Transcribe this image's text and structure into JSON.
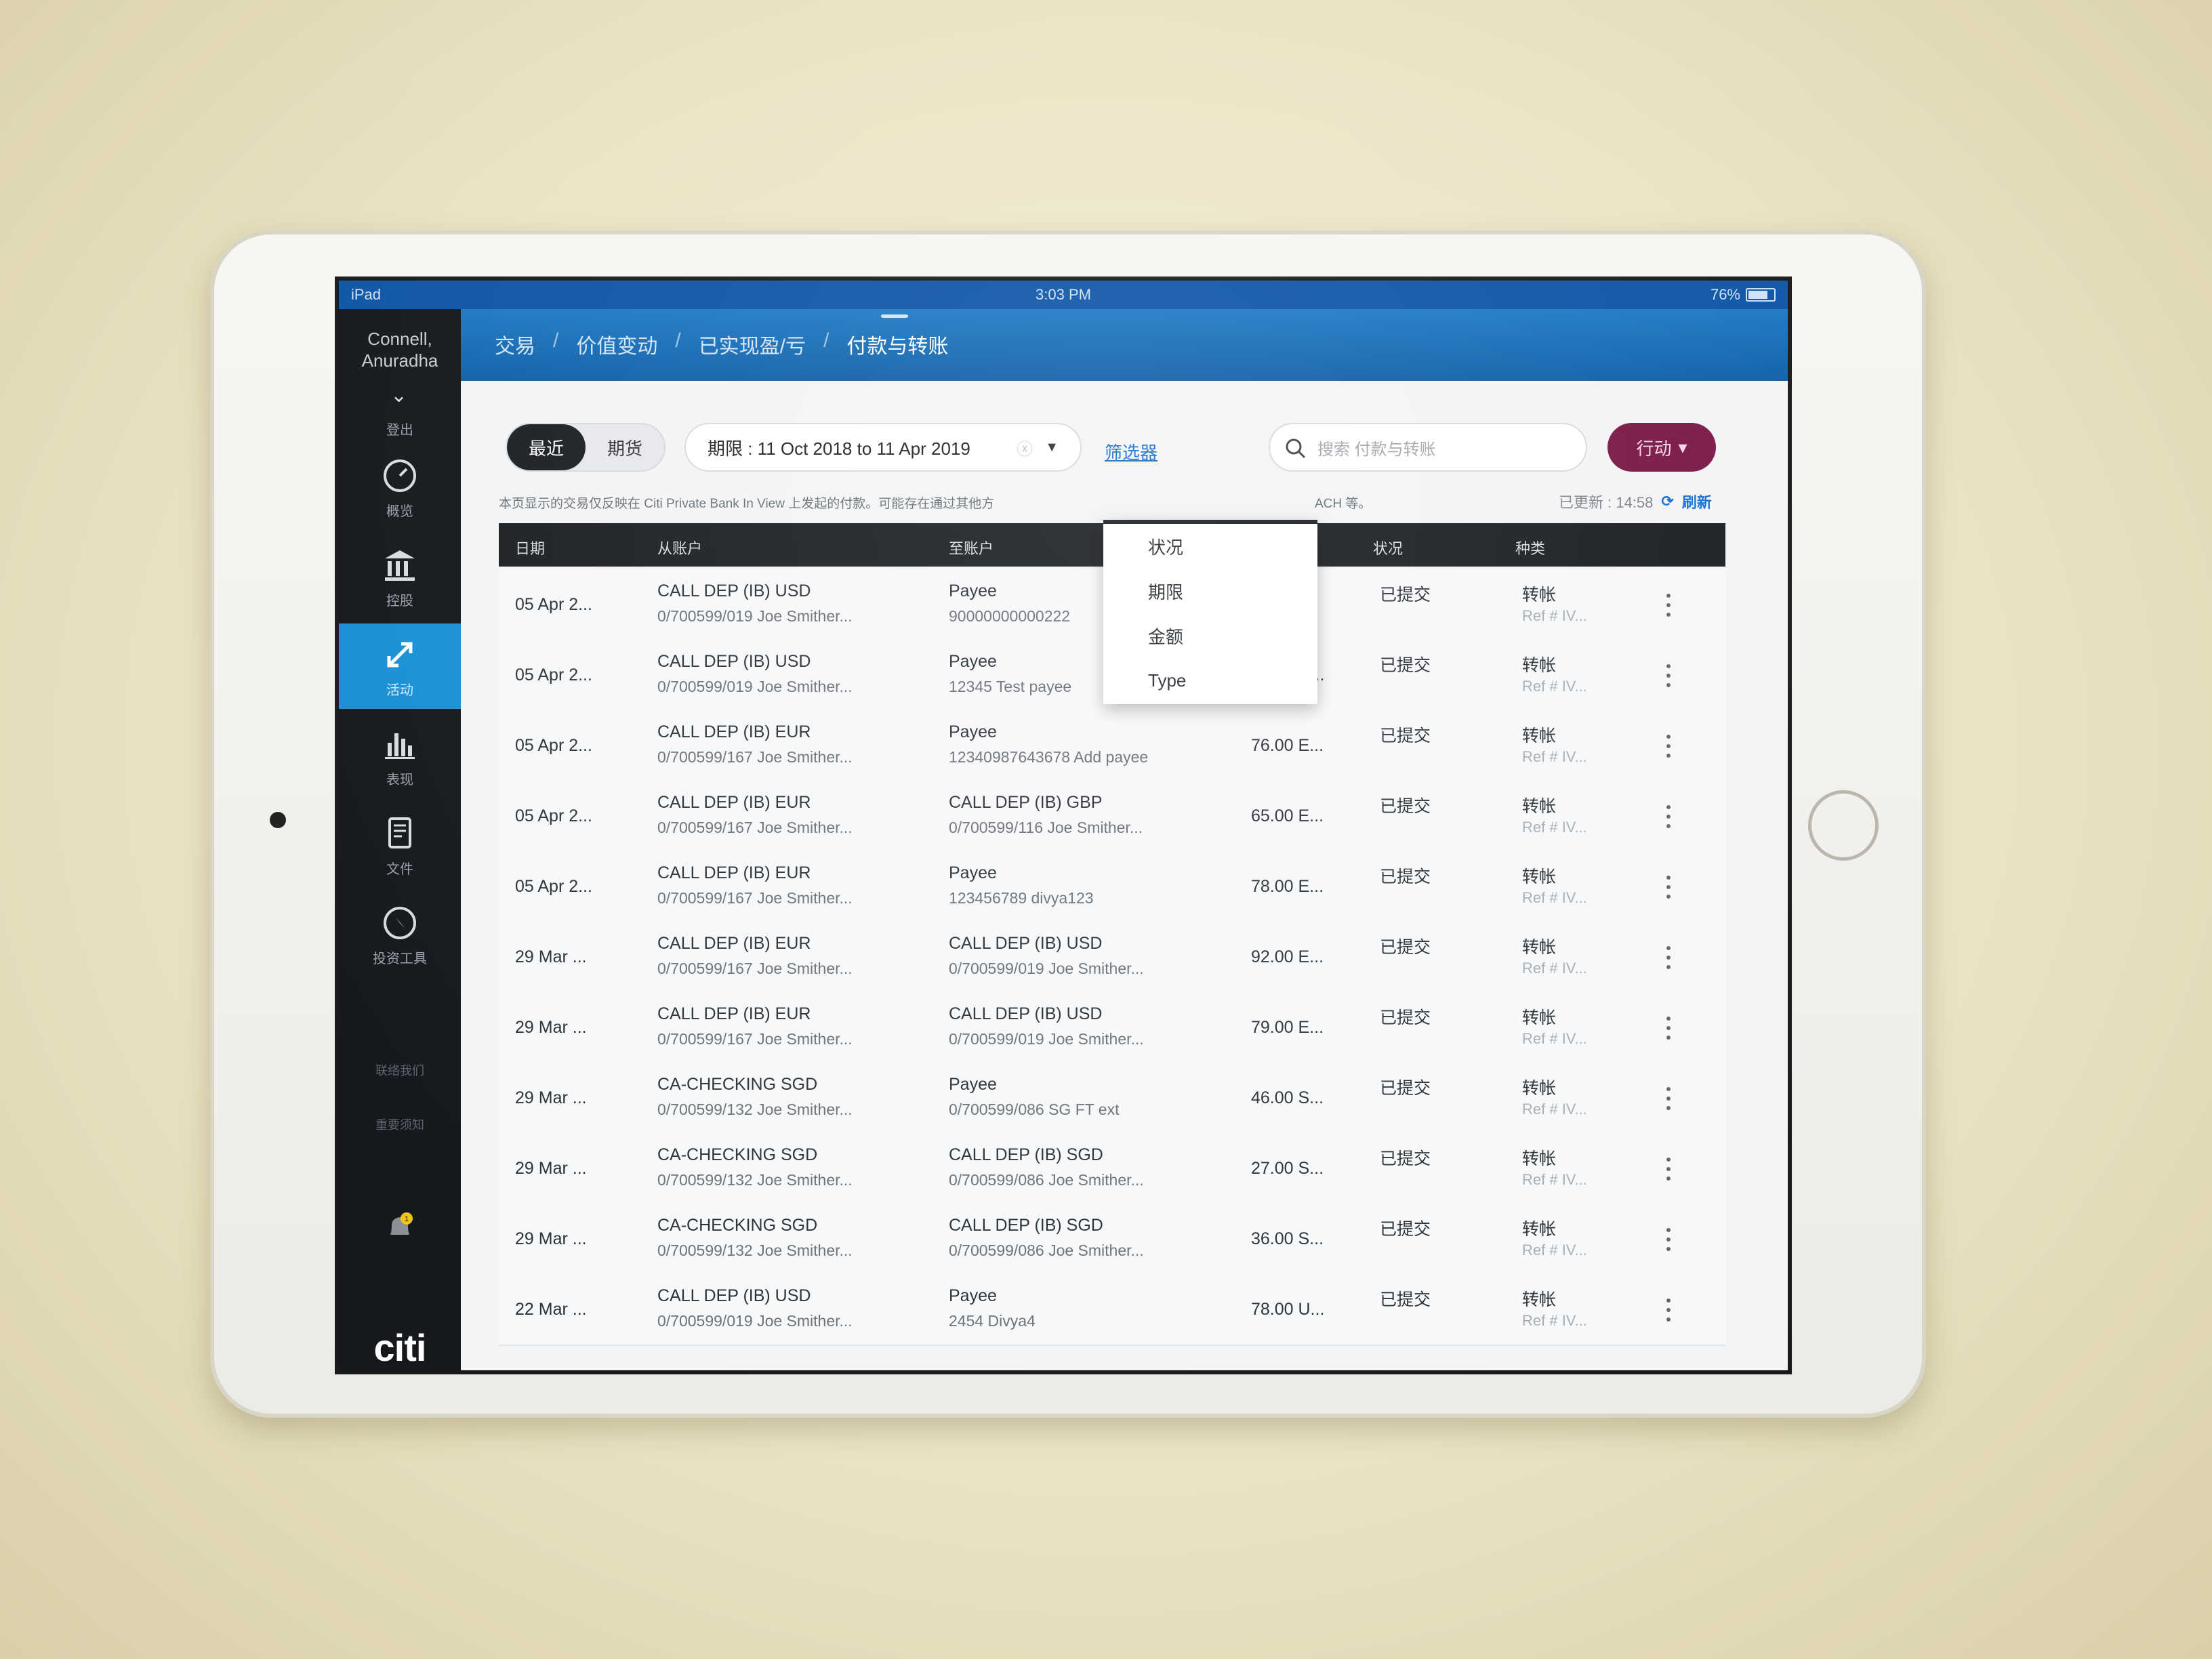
{
  "status_bar": {
    "device": "iPad",
    "time": "3:03 PM",
    "battery": "76%"
  },
  "sidebar": {
    "user_name": "Connell, Anuradha",
    "logout_label": "登出",
    "items": [
      {
        "label": "概览",
        "icon": "gauge-icon"
      },
      {
        "label": "控股",
        "icon": "bank-icon"
      },
      {
        "label": "活动",
        "icon": "arrows-icon"
      },
      {
        "label": "表现",
        "icon": "bar-chart-icon"
      },
      {
        "label": "文件",
        "icon": "document-icon"
      },
      {
        "label": "投资工具",
        "icon": "compass-icon"
      }
    ],
    "links": [
      "联络我们",
      "重要须知"
    ],
    "notification_count": "1",
    "brand": "citi"
  },
  "breadcrumb": [
    "交易",
    "价值变动",
    "已实现盈/亏",
    "付款与转账"
  ],
  "toolbar": {
    "segment_recent": "最近",
    "segment_other": "期货",
    "period_label": "期限 : 11 Oct 2018 to 11 Apr 2019",
    "filter_link": "筛选器",
    "search_placeholder": "搜索 付款与转账",
    "action_button": "行动"
  },
  "notice": {
    "text_left": "本页显示的交易仅反映在 Citi Private Bank In View 上发起的付款。可能存在通过其他方",
    "text_right": "ACH 等。",
    "updated_label": "已更新 : 14:58",
    "refresh_label": "刷新"
  },
  "filter_menu": [
    "状况",
    "期限",
    "金额",
    "Type"
  ],
  "table": {
    "headers": {
      "date": "日期",
      "from": "从账户",
      "to": "至账户",
      "amount": "",
      "status": "状况",
      "type": "种类"
    },
    "rows": [
      {
        "date": "05 Apr 2...",
        "from_1": "CALL DEP (IB) USD",
        "from_2": "0/700599/019 Joe Smither...",
        "to_1": "Payee",
        "to_2": "90000000000222",
        "amount": "",
        "status": "已提交",
        "type": "转帐",
        "ref": "Ref # IV..."
      },
      {
        "date": "05 Apr 2...",
        "from_1": "CALL DEP (IB) USD",
        "from_2": "0/700599/019 Joe Smither...",
        "to_1": "Payee",
        "to_2": "12345 Test payee",
        "amount": "42.00 U...",
        "status": "已提交",
        "type": "转帐",
        "ref": "Ref # IV..."
      },
      {
        "date": "05 Apr 2...",
        "from_1": "CALL DEP (IB) EUR",
        "from_2": "0/700599/167 Joe Smither...",
        "to_1": "Payee",
        "to_2": "12340987643678 Add payee",
        "amount": "76.00 E...",
        "status": "已提交",
        "type": "转帐",
        "ref": "Ref # IV..."
      },
      {
        "date": "05 Apr 2...",
        "from_1": "CALL DEP (IB) EUR",
        "from_2": "0/700599/167 Joe Smither...",
        "to_1": "CALL DEP (IB) GBP",
        "to_2": "0/700599/116 Joe Smither...",
        "amount": "65.00 E...",
        "status": "已提交",
        "type": "转帐",
        "ref": "Ref # IV..."
      },
      {
        "date": "05 Apr 2...",
        "from_1": "CALL DEP (IB) EUR",
        "from_2": "0/700599/167 Joe Smither...",
        "to_1": "Payee",
        "to_2": "123456789 divya123",
        "amount": "78.00 E...",
        "status": "已提交",
        "type": "转帐",
        "ref": "Ref # IV..."
      },
      {
        "date": "29 Mar ...",
        "from_1": "CALL DEP (IB) EUR",
        "from_2": "0/700599/167 Joe Smither...",
        "to_1": "CALL DEP (IB) USD",
        "to_2": "0/700599/019 Joe Smither...",
        "amount": "92.00 E...",
        "status": "已提交",
        "type": "转帐",
        "ref": "Ref # IV..."
      },
      {
        "date": "29 Mar ...",
        "from_1": "CALL DEP (IB) EUR",
        "from_2": "0/700599/167 Joe Smither...",
        "to_1": "CALL DEP (IB) USD",
        "to_2": "0/700599/019 Joe Smither...",
        "amount": "79.00 E...",
        "status": "已提交",
        "type": "转帐",
        "ref": "Ref # IV..."
      },
      {
        "date": "29 Mar ...",
        "from_1": "CA-CHECKING SGD",
        "from_2": "0/700599/132 Joe Smither...",
        "to_1": "Payee",
        "to_2": "0/700599/086 SG FT ext",
        "amount": "46.00 S...",
        "status": "已提交",
        "type": "转帐",
        "ref": "Ref # IV..."
      },
      {
        "date": "29 Mar ...",
        "from_1": "CA-CHECKING SGD",
        "from_2": "0/700599/132 Joe Smither...",
        "to_1": "CALL DEP (IB) SGD",
        "to_2": "0/700599/086 Joe Smither...",
        "amount": "27.00 S...",
        "status": "已提交",
        "type": "转帐",
        "ref": "Ref # IV..."
      },
      {
        "date": "29 Mar ...",
        "from_1": "CA-CHECKING SGD",
        "from_2": "0/700599/132 Joe Smither...",
        "to_1": "CALL DEP (IB) SGD",
        "to_2": "0/700599/086 Joe Smither...",
        "amount": "36.00 S...",
        "status": "已提交",
        "type": "转帐",
        "ref": "Ref # IV..."
      },
      {
        "date": "22 Mar ...",
        "from_1": "CALL DEP (IB) USD",
        "from_2": "0/700599/019 Joe Smither...",
        "to_1": "Payee",
        "to_2": "2454 Divya4",
        "amount": "78.00 U...",
        "status": "已提交",
        "type": "转帐",
        "ref": "Ref # IV..."
      }
    ]
  },
  "colors": {
    "topbar": "#1f7ac4",
    "active_nav": "#1a8fd6",
    "action_button": "#7a1847",
    "link": "#1a6fd0"
  }
}
